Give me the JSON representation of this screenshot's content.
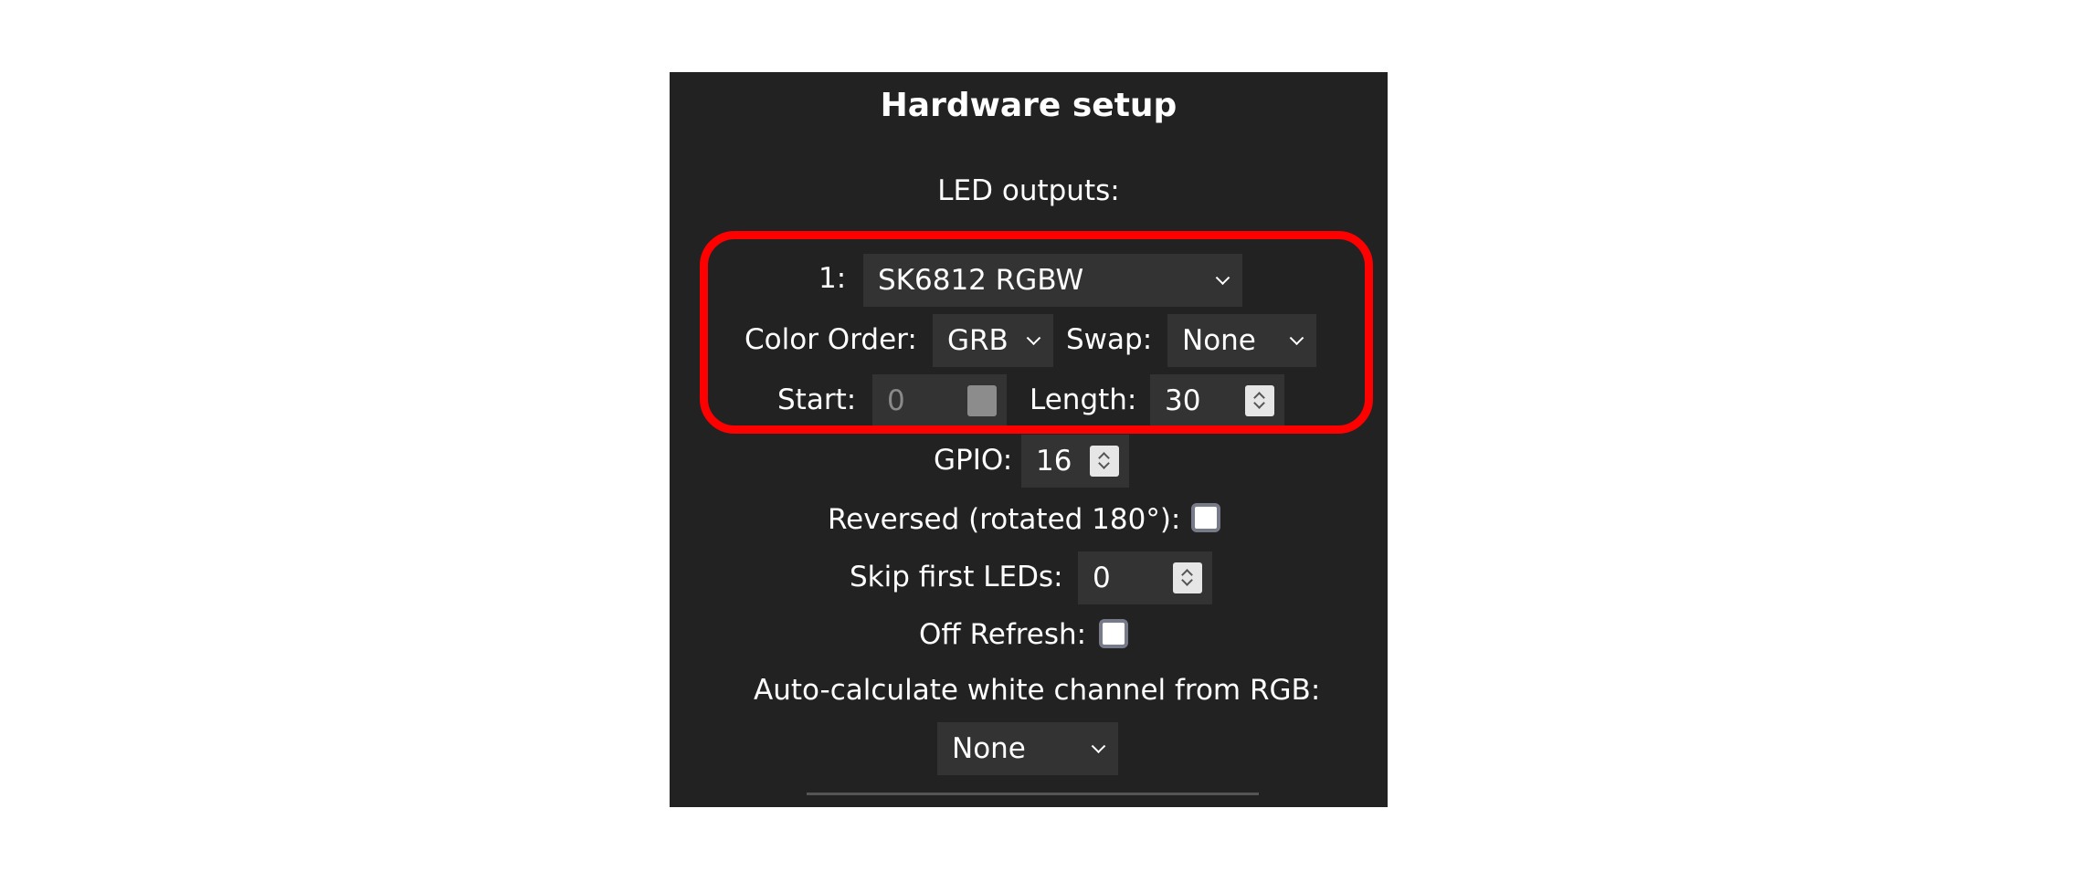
{
  "title": "Hardware setup",
  "led_outputs_label": "LED outputs:",
  "output": {
    "index_label": "1:",
    "led_type": "SK6812 RGBW",
    "color_order_label": "Color Order:",
    "color_order_value": "GRB",
    "swap_label": "Swap:",
    "swap_value": "None",
    "start_label": "Start:",
    "start_value": "0",
    "length_label": "Length:",
    "length_value": "30",
    "gpio_label": "GPIO:",
    "gpio_value": "16",
    "reversed_label": "Reversed (rotated 180°):",
    "reversed_checked": false,
    "skip_label": "Skip first LEDs:",
    "skip_value": "0",
    "off_refresh_label": "Off Refresh:",
    "off_refresh_checked": false,
    "auto_white_label": "Auto-calculate white channel from RGB:",
    "auto_white_value": "None"
  },
  "colors": {
    "panel_bg": "#222222",
    "control_bg": "#333333",
    "highlight": "#ff0000"
  },
  "icons": [
    "chevron-down-icon",
    "spinner-arrows-icon",
    "checkbox-icon"
  ]
}
